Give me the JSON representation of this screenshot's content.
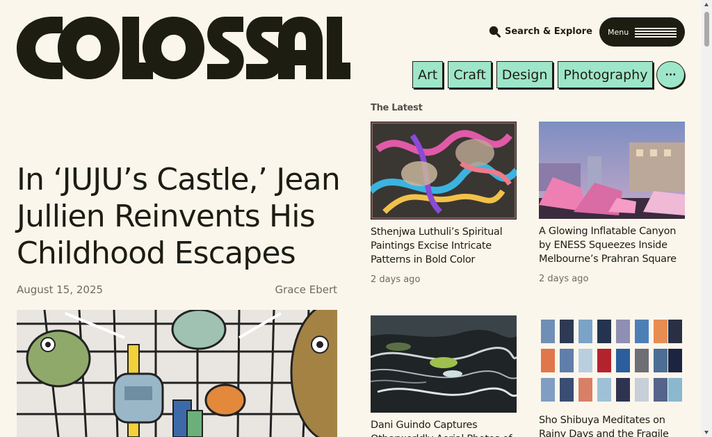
{
  "header": {
    "logo_text": "COLOSSAL",
    "search_label": "Search & Explore",
    "menu_label": "Menu",
    "search_icon": "search-icon",
    "menu_icon": "hamburger-icon"
  },
  "categories": [
    {
      "label": "Art"
    },
    {
      "label": "Craft"
    },
    {
      "label": "Design"
    },
    {
      "label": "Photography"
    }
  ],
  "more_label": "···",
  "feature": {
    "title": "In ‘JUJU’s Castle,’ Jean Jullien Reinvents His Childhood Escapes",
    "date": "August 15, 2025",
    "author": "Grace Ebert"
  },
  "latest": {
    "label": "The Latest",
    "items": [
      {
        "title": "Sthenjwa Luthuli’s Spiritual Paintings Excise Intricate Patterns in Bold Color",
        "date": "2 days ago"
      },
      {
        "title": "A Glowing Inflatable Canyon by ENESS Squeezes Inside Melbourne’s Prahran Square",
        "date": "2 days ago"
      },
      {
        "title": "Dani Guindo Captures Otherworldly Aerial Photos of",
        "date": ""
      },
      {
        "title": "Sho Shibuya Meditates on Rainy Days and the Fragile",
        "date": ""
      }
    ]
  },
  "colors": {
    "background": "#fbf6ec",
    "ink": "#1d1d12",
    "accent": "#9ee6c9",
    "muted": "#6f6b60"
  }
}
